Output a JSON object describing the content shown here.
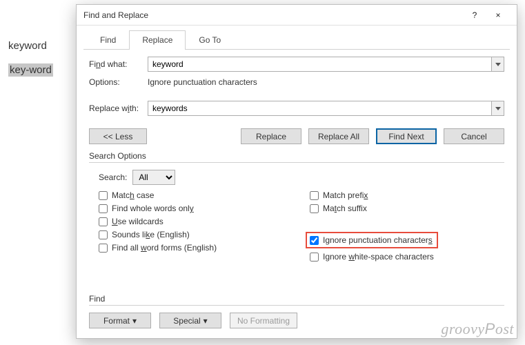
{
  "doc": {
    "word1": "keyword",
    "word2": "key-word"
  },
  "dialog": {
    "title": "Find and Replace",
    "help": "?",
    "close": "×",
    "tabs": {
      "find": "Find",
      "replace": "Replace",
      "goto": "Go To"
    },
    "find_what_label": "Find what:",
    "find_what_value": "keyword",
    "options_label": "Options:",
    "options_value": "Ignore punctuation characters",
    "replace_with_label": "Replace with:",
    "replace_with_value": "keywords",
    "buttons": {
      "less": "<< Less",
      "replace": "Replace",
      "replace_all": "Replace All",
      "find_next": "Find Next",
      "cancel": "Cancel"
    },
    "search_options_label": "Search Options",
    "search_label": "Search:",
    "search_value": "All",
    "checks": {
      "match_case": "Match case",
      "whole_words": "Find whole words only",
      "wildcards": "Use wildcards",
      "sounds_like": "Sounds like (English)",
      "word_forms": "Find all word forms (English)",
      "match_prefix": "Match prefix",
      "match_suffix": "Match suffix",
      "ignore_punct": "Ignore punctuation characters",
      "ignore_ws": "Ignore white-space characters"
    },
    "find_label": "Find",
    "format": "Format",
    "special": "Special",
    "no_formatting": "No Formatting"
  },
  "watermark": "groovyPost"
}
